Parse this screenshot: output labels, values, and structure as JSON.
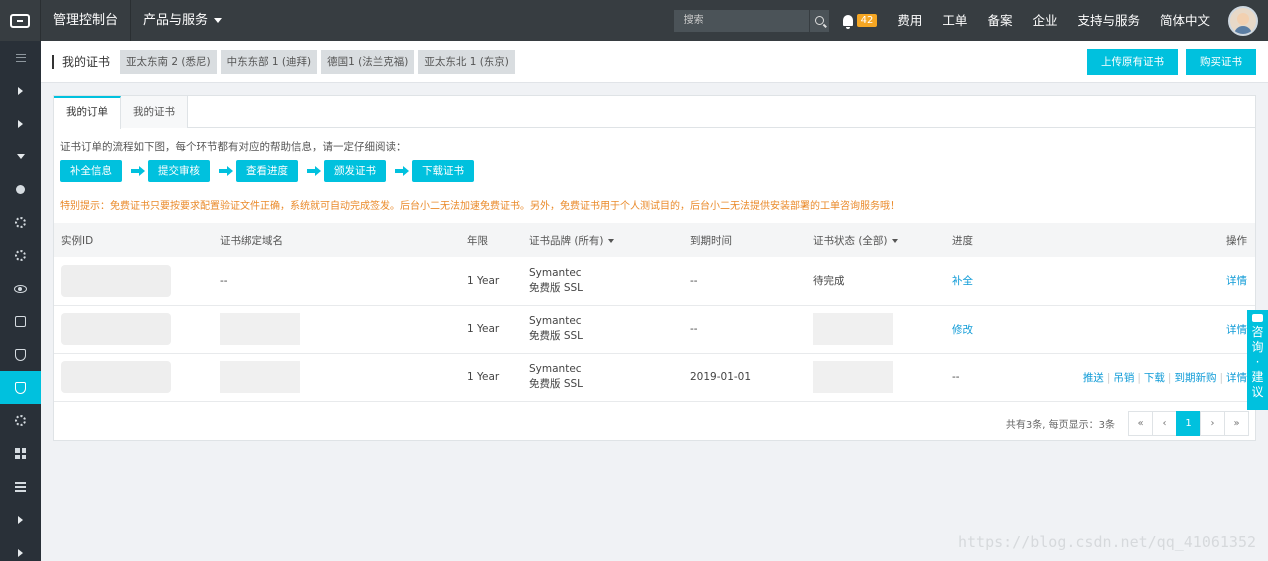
{
  "topbar": {
    "title": "管理控制台",
    "products": "产品与服务",
    "search_placeholder": "搜索",
    "notification_count": "42",
    "links": [
      "费用",
      "工单",
      "备案",
      "企业",
      "支持与服务",
      "简体中文"
    ]
  },
  "subheader": {
    "title": "我的证书",
    "regions": [
      "亚太东南 2 (悉尼)",
      "中东东部 1 (迪拜)",
      "德国1 (法兰克福)",
      "亚太东北 1 (东京)"
    ],
    "upload_btn": "上传原有证书",
    "buy_btn": "购买证书"
  },
  "tabs": [
    "我的订单",
    "我的证书"
  ],
  "intro": "证书订单的流程如下图，每个环节都有对应的帮助信息，请一定仔细阅读：",
  "steps": [
    "补全信息",
    "提交审核",
    "查看进度",
    "颁发证书",
    "下载证书"
  ],
  "tip": "特别提示：免费证书只要按要求配置验证文件正确，系统就可自动完成签发。后台小二无法加速免费证书。另外，免费证书用于个人测试目的，后台小二无法提供安装部署的工单咨询服务哦！",
  "table": {
    "headers": [
      "实例ID",
      "证书绑定域名",
      "年限",
      "证书品牌 (所有)",
      "到期时间",
      "证书状态 (全部)",
      "进度",
      "操作"
    ],
    "rows": [
      {
        "domain": "--",
        "years": "1 Year",
        "brand1": "Symantec",
        "brand2": "免费版 SSL",
        "expire": "--",
        "status": "待完成",
        "progress": "补全",
        "ops": [
          "详情"
        ]
      },
      {
        "domain": "",
        "years": "1 Year",
        "brand1": "Symantec",
        "brand2": "免费版 SSL",
        "expire": "--",
        "status": "",
        "progress": "修改",
        "ops": [
          "详情"
        ]
      },
      {
        "domain": "",
        "years": "1 Year",
        "brand1": "Symantec",
        "brand2": "免费版 SSL",
        "expire": "2019-01-01",
        "status": "",
        "progress": "--",
        "ops": [
          "推送",
          "吊销",
          "下载",
          "到期新购",
          "详情"
        ]
      }
    ]
  },
  "pager": {
    "info": "共有3条, 每页显示：3条",
    "first": "«",
    "prev": "‹",
    "current": "1",
    "next": "›",
    "last": "»"
  },
  "float": [
    "咨",
    "询",
    "·",
    "建",
    "议"
  ],
  "watermark": "https://blog.csdn.net/qq_41061352",
  "colors": {
    "accent": "#00c1de",
    "topbar": "#373d41",
    "sidebar": "#293038",
    "tip": "#ea8a2a",
    "badge": "#f5a623"
  }
}
